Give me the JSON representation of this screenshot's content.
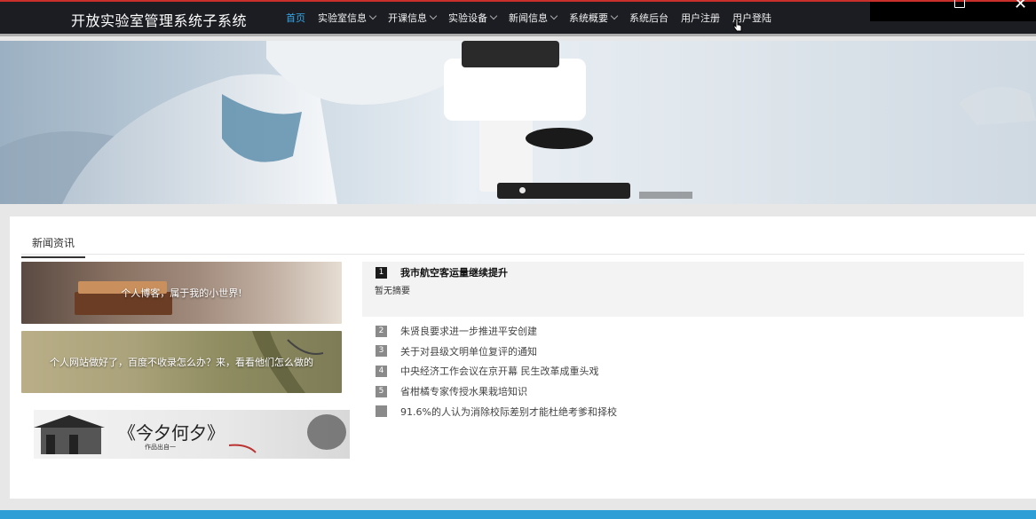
{
  "brand": "开放实验室管理系统子系统",
  "nav": [
    {
      "label": "首页",
      "active": true,
      "dropdown": false
    },
    {
      "label": "实验室信息",
      "active": false,
      "dropdown": true
    },
    {
      "label": "开课信息",
      "active": false,
      "dropdown": true
    },
    {
      "label": "实验设备",
      "active": false,
      "dropdown": true
    },
    {
      "label": "新闻信息",
      "active": false,
      "dropdown": true
    },
    {
      "label": "系统概要",
      "active": false,
      "dropdown": true
    },
    {
      "label": "系统后台",
      "active": false,
      "dropdown": false
    },
    {
      "label": "用户注册",
      "active": false,
      "dropdown": false
    },
    {
      "label": "用户登陆",
      "active": false,
      "dropdown": false
    }
  ],
  "section_tab": "新闻资讯",
  "cards": [
    {
      "caption": "个人博客，属于我的小世界!"
    },
    {
      "caption": "个人网站做好了，百度不收录怎么办？来，看看他们怎么做的"
    }
  ],
  "card3_logo": "《今夕何夕》",
  "card3_sub": "作品出自一",
  "news_featured": {
    "rank": "1",
    "title": "我市航空客运量继续提升",
    "summary": "暂无摘要"
  },
  "news_items": [
    {
      "rank": "2",
      "title": "朱贤良要求进一步推进平安创建"
    },
    {
      "rank": "3",
      "title": "关于对县级文明单位复评的通知"
    },
    {
      "rank": "4",
      "title": "中央经济工作会议在京开幕 民生改革成重头戏"
    },
    {
      "rank": "5",
      "title": "省柑橘专家传授水果栽培知识"
    },
    {
      "rank": "",
      "title": "91.6%的人认为消除校际差别才能杜绝考爹和择校"
    }
  ],
  "colors": {
    "nav_bg": "#1b1d22",
    "nav_active": "#35a7e8",
    "footer": "#2e9fd6"
  }
}
